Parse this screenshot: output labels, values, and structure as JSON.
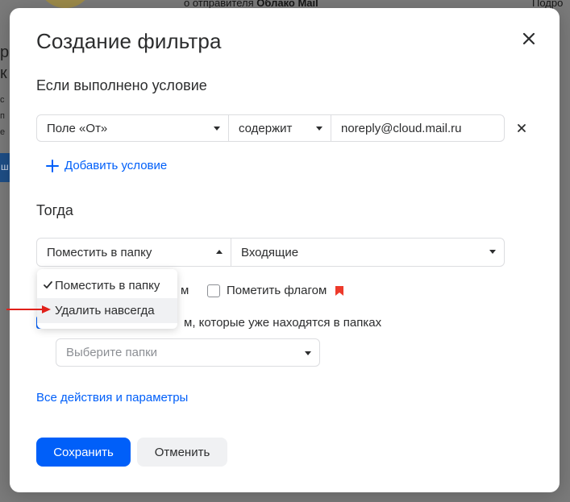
{
  "background": {
    "sender_text_prefix": "о отправителя ",
    "sender_name": "Облако Mail",
    "right_text": "Подро",
    "left_chars": [
      "р",
      "к",
      "с",
      "п",
      "е"
    ],
    "blue_btn_char": "ш"
  },
  "modal": {
    "title": "Создание фильтра",
    "close_icon": "close-icon"
  },
  "condition": {
    "heading": "Если выполнено условие",
    "field_label": "Поле «От»",
    "operator_label": "содержит",
    "value": "noreply@cloud.mail.ru",
    "add_label": "Добавить условие"
  },
  "action": {
    "heading": "Тогда",
    "action_label": "Поместить в папку",
    "folder_label": "Входящие",
    "mark_read_tail": "м",
    "flag_label": "Пометить флагом",
    "apply_existing_label": "м, которые уже находятся в папках",
    "folders_placeholder": "Выберите папки"
  },
  "dropdown": {
    "items": [
      {
        "label": "Поместить в папку",
        "selected": true
      },
      {
        "label": "Удалить навсегда",
        "selected": false
      }
    ]
  },
  "links": {
    "all_actions": "Все действия и параметры"
  },
  "buttons": {
    "save": "Сохранить",
    "cancel": "Отменить"
  },
  "colors": {
    "accent": "#005ff9",
    "flag": "#ed3a2b",
    "annotation_arrow": "#e0201a"
  }
}
